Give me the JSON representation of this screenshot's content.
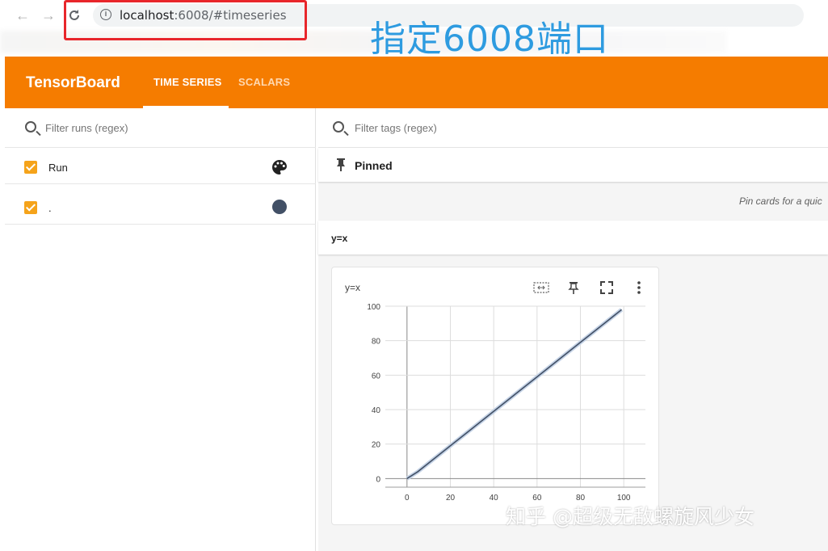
{
  "browser": {
    "address_host": "localhost",
    "address_rest": ":6008/#timeseries",
    "annotation": "指定6008端口"
  },
  "header": {
    "logo": "TensorBoard",
    "tabs": [
      {
        "label": "TIME SERIES",
        "active": true
      },
      {
        "label": "SCALARS",
        "active": false
      }
    ],
    "accent": "#f57c00"
  },
  "runs_panel": {
    "filter_placeholder": "Filter runs (regex)",
    "runs": [
      {
        "label": "Run",
        "checked": true,
        "icon": "palette-icon"
      },
      {
        "label": ".",
        "checked": true,
        "color": "#425066"
      }
    ]
  },
  "main": {
    "filter_placeholder": "Filter tags (regex)",
    "pinned_label": "Pinned",
    "pin_hint": "Pin cards for a quic",
    "group_label": "y=x",
    "card": {
      "title": "y=x",
      "tools": [
        "fit-domain-icon",
        "pin-icon",
        "fullscreen-icon",
        "more-vert-icon"
      ]
    }
  },
  "chart_data": {
    "type": "line",
    "title": "y=x",
    "x": [
      0,
      5,
      10,
      20,
      30,
      40,
      50,
      60,
      70,
      80,
      90,
      99
    ],
    "series": [
      {
        "values": [
          0,
          4,
          9,
          19,
          29,
          39,
          49,
          59,
          69,
          79,
          89,
          98
        ],
        "color": "#425066"
      }
    ],
    "x_ticks": [
      0,
      20,
      40,
      60,
      80,
      100
    ],
    "y_ticks": [
      0,
      20,
      40,
      60,
      80,
      100
    ],
    "xlim": [
      -10,
      110
    ],
    "ylim": [
      -5,
      100
    ],
    "grid": true
  },
  "watermark": "知乎 @超级无敌螺旋风少女"
}
